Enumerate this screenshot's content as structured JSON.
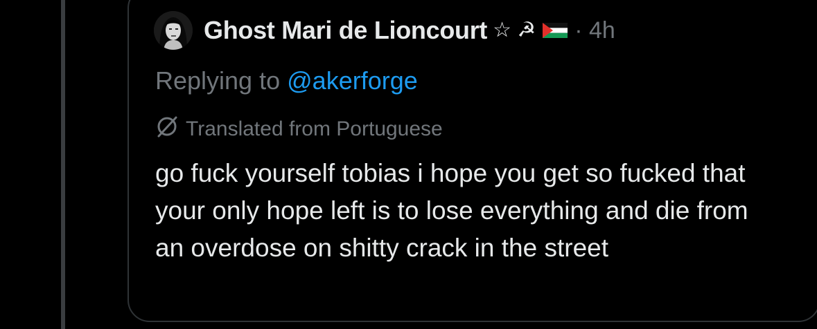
{
  "post": {
    "display_name": "Ghost Mari de Lioncourt",
    "name_badges": "☆ ☭",
    "flag_icon": "palestine-flag-icon",
    "separator_time": "· 4h",
    "replying_prefix": "Replying to",
    "replying_handle": "@akerforge",
    "translated_label": "Translated from Portuguese",
    "body": "go fuck yourself tobias i hope you get so fucked that your only hope left is to lose everything and die from an overdose on shitty crack in the street"
  },
  "colors": {
    "background": "#000000",
    "text": "#e7e9ea",
    "muted": "#71767b",
    "link": "#1d9bf0",
    "border": "#2f3336"
  }
}
